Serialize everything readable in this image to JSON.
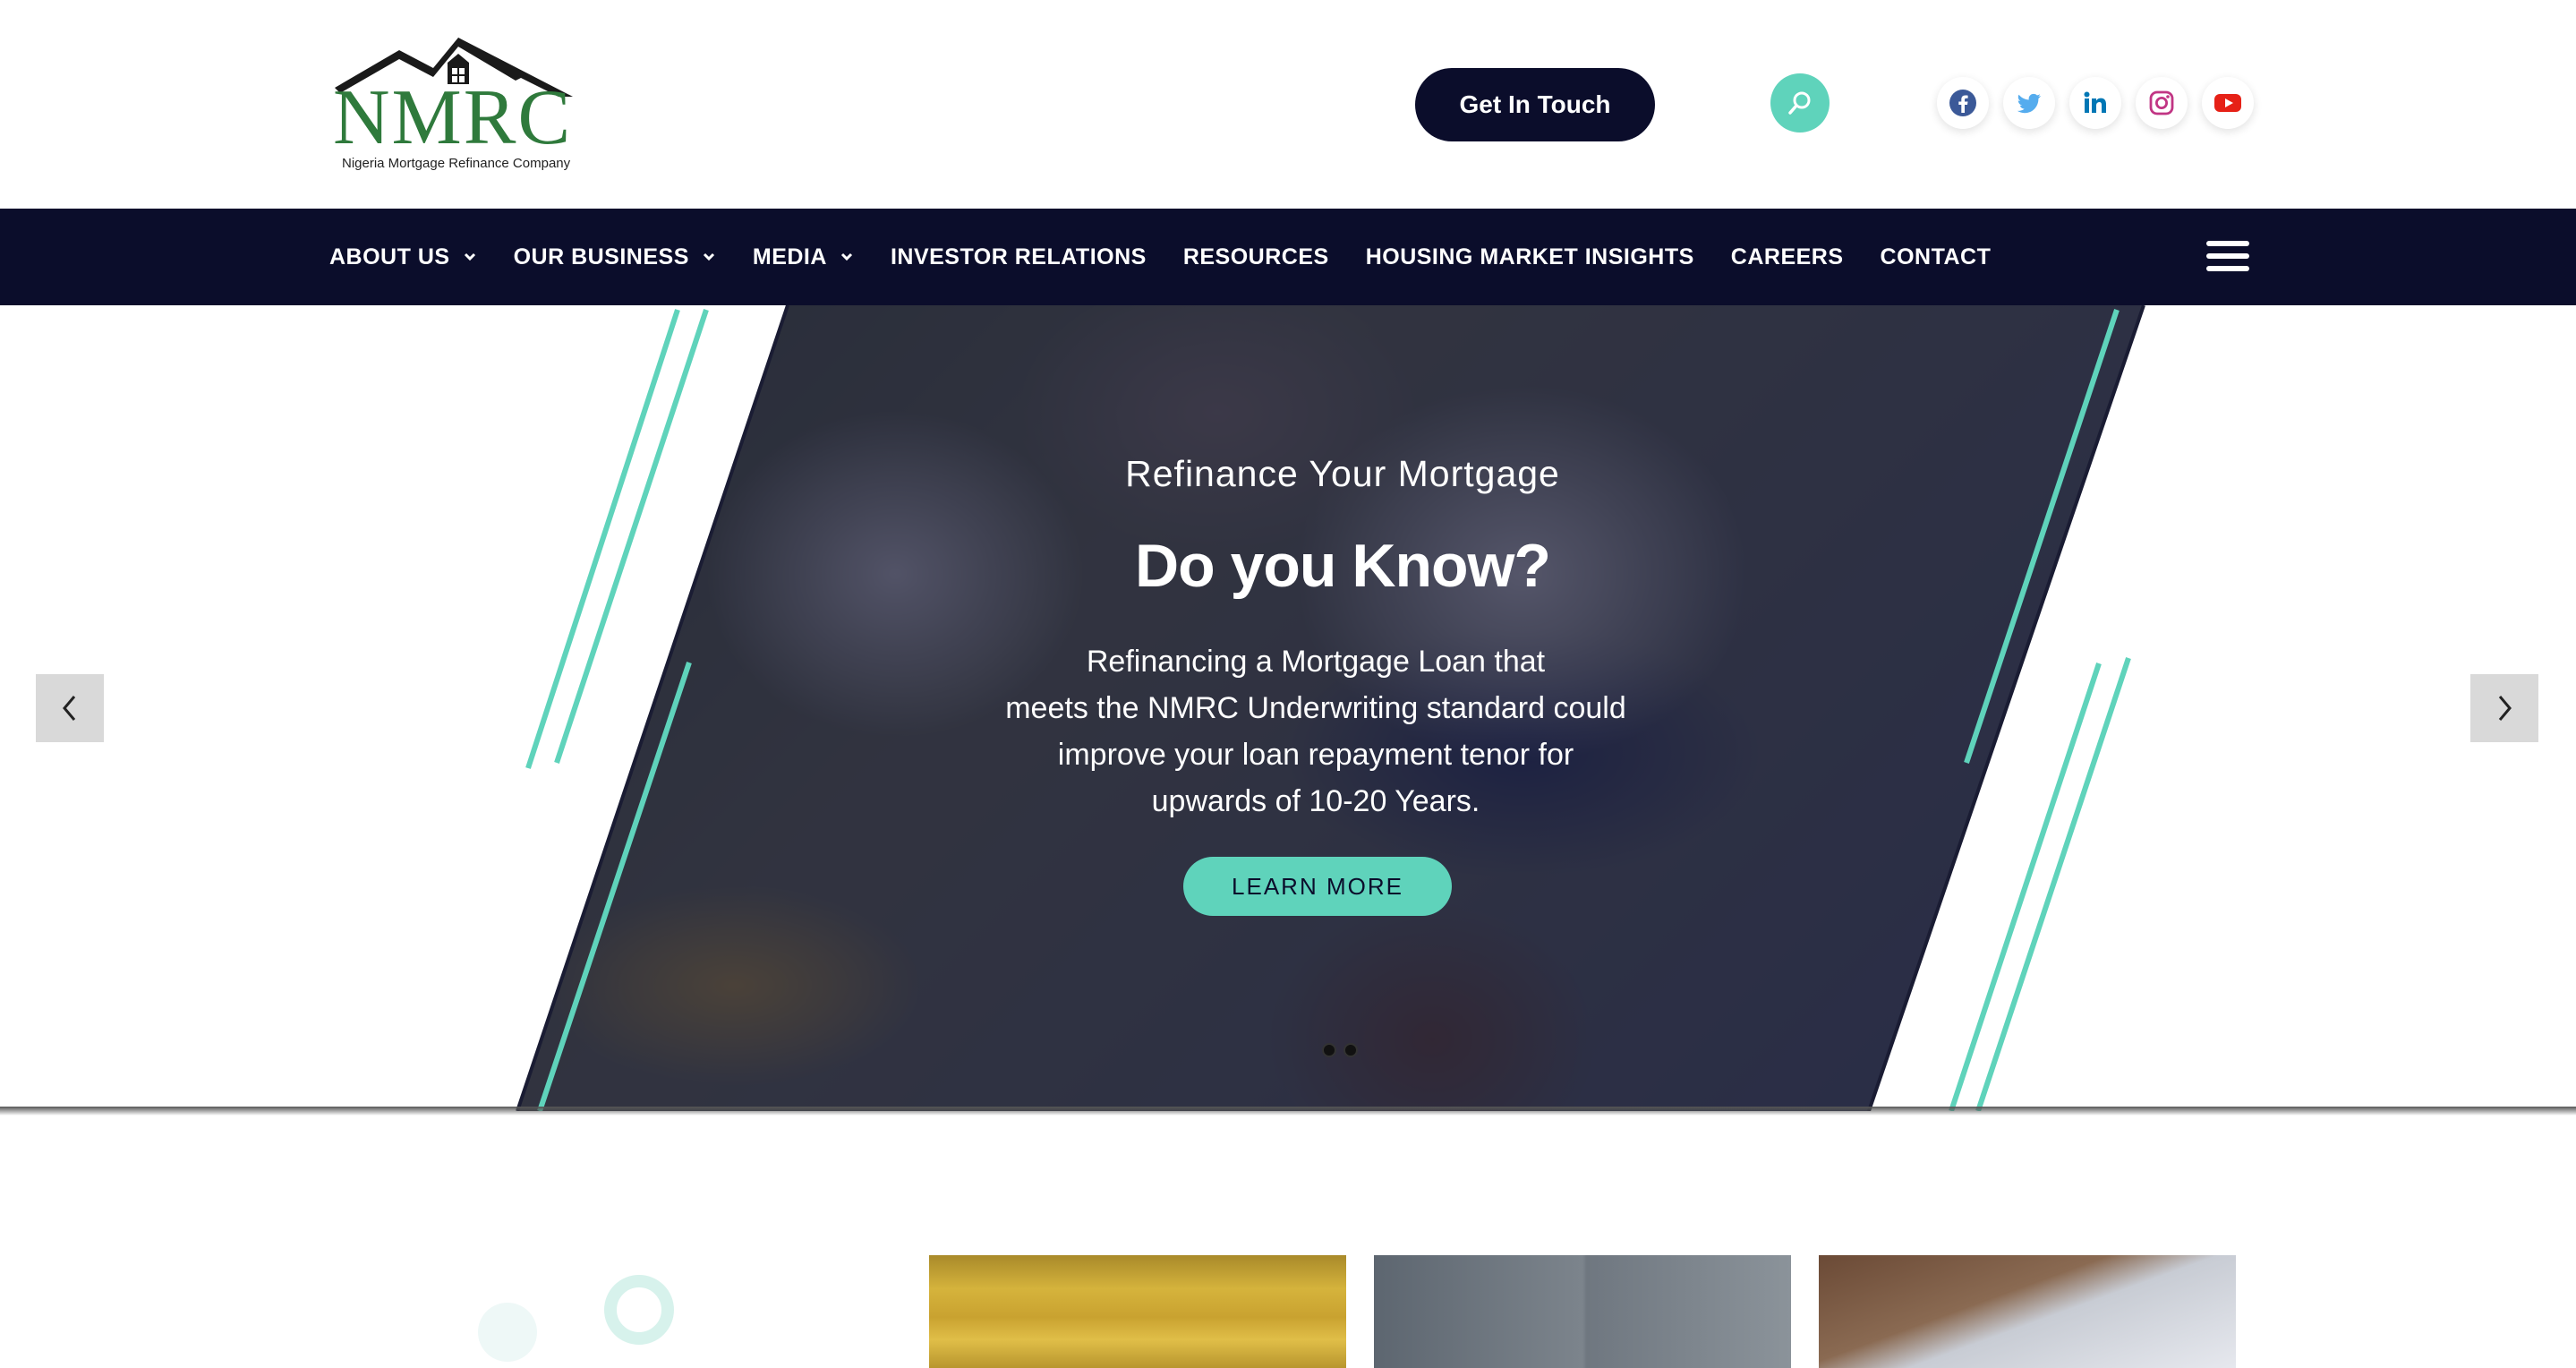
{
  "header": {
    "logo": {
      "text": "NMRC",
      "tagline": "Nigeria Mortgage Refinance Company"
    },
    "cta_label": "Get In Touch",
    "search_icon": "search-icon",
    "socials": [
      {
        "name": "facebook-icon",
        "color": "#3b5998"
      },
      {
        "name": "twitter-icon",
        "color": "#55acee"
      },
      {
        "name": "linkedin-icon",
        "color": "#0077b5"
      },
      {
        "name": "instagram-icon",
        "color": "#c13584"
      },
      {
        "name": "youtube-icon",
        "color": "#e62117"
      }
    ]
  },
  "nav": {
    "items": [
      {
        "label": "ABOUT US",
        "dropdown": true
      },
      {
        "label": "OUR BUSINESS",
        "dropdown": true
      },
      {
        "label": "MEDIA",
        "dropdown": true
      },
      {
        "label": "INVESTOR RELATIONS",
        "dropdown": false
      },
      {
        "label": "RESOURCES",
        "dropdown": false
      },
      {
        "label": "HOUSING MARKET INSIGHTS",
        "dropdown": false
      },
      {
        "label": "CAREERS",
        "dropdown": false
      },
      {
        "label": "CONTACT",
        "dropdown": false
      }
    ],
    "menu_icon": "hamburger-menu-icon"
  },
  "hero": {
    "subtitle": "Refinance Your Mortgage",
    "title": "Do you Know?",
    "body_lines": [
      "Refinancing a Mortgage Loan that",
      "meets the NMRC Underwriting standard could",
      "improve your loan repayment tenor for",
      "upwards of 10-20 Years."
    ],
    "button_label": "LEARN MORE",
    "slide_count": 2,
    "active_slide": 1,
    "prev_icon": "chevron-left-icon",
    "next_icon": "chevron-right-icon"
  },
  "colors": {
    "navy": "#0b0d2b",
    "accent": "#5fd3bb",
    "logo_green": "#2f7a3c"
  }
}
